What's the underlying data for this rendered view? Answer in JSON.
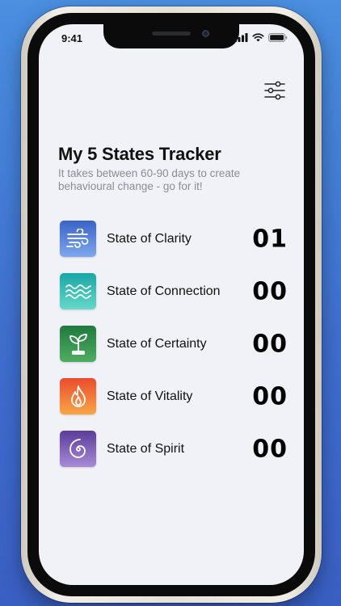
{
  "status_bar": {
    "time": "9:41",
    "icons": [
      "signal-icon",
      "wifi-icon",
      "battery-icon"
    ]
  },
  "toolbar": {
    "filter_icon": "sliders-icon"
  },
  "header": {
    "title": "My 5 States Tracker",
    "subtitle": "It takes between 60-90 days to create behavioural change - go for it!"
  },
  "states": [
    {
      "label": "State of Clarity",
      "count": "01",
      "icon": "wind-icon",
      "color_top": "#3a63c8",
      "color_bottom": "#7ea7ec"
    },
    {
      "label": "State of Connection",
      "count": "00",
      "icon": "waves-icon",
      "color_top": "#1aa6a6",
      "color_bottom": "#66d8c8"
    },
    {
      "label": "State of Certainty",
      "count": "00",
      "icon": "sprout-icon",
      "color_top": "#1e7a3e",
      "color_bottom": "#4fae62"
    },
    {
      "label": "State of Vitality",
      "count": "00",
      "icon": "flame-icon",
      "color_top": "#ea4c2e",
      "color_bottom": "#f8a646"
    },
    {
      "label": "State of Spirit",
      "count": "00",
      "icon": "spiral-icon",
      "color_top": "#5a3c9a",
      "color_bottom": "#a98ad6"
    }
  ]
}
